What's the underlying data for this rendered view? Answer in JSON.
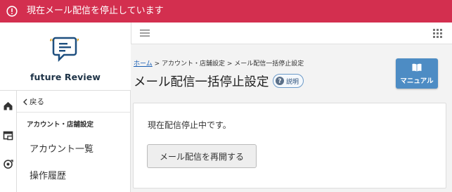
{
  "banner": {
    "text": "現在メール配信を停止しています",
    "icon": "alert-circle-icon",
    "color": "#d32f4f"
  },
  "brand": {
    "name": "future Review",
    "icon": "speech-bubble-logo-icon"
  },
  "sidebar": {
    "icons": [
      "home-icon",
      "store-icon",
      "settings-cycle-icon"
    ],
    "back_label": "戻る",
    "section_title": "アカウント・店舗設定",
    "items": [
      {
        "label": "アカウント一覧"
      },
      {
        "label": "操作履歴"
      }
    ]
  },
  "topbar": {
    "menu_icon": "hamburger-icon",
    "apps_icon": "grid-icon"
  },
  "breadcrumb": {
    "home": "ホーム",
    "sep1": " > ",
    "level2": "アカウント・店舗設定",
    "sep2": " > ",
    "current": "メール配信一括停止設定"
  },
  "page": {
    "title": "メール配信一括停止設定",
    "help_label": "説明",
    "manual_label": "マニュアル"
  },
  "card": {
    "status_text": "現在配信停止中です。",
    "resume_button": "メール配信を再開する"
  },
  "colors": {
    "banner": "#d32f4f",
    "manual_button": "#4d8cc4",
    "brand_text": "#1e3347",
    "link": "#1a5fb4"
  }
}
